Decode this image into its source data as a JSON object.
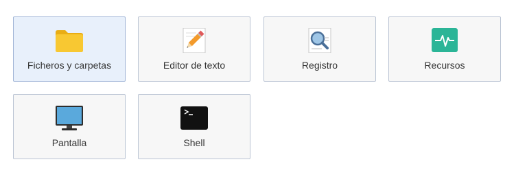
{
  "tiles": [
    {
      "label": "Ficheros y carpetas",
      "icon": "folder-icon",
      "selected": true
    },
    {
      "label": "Editor de texto",
      "icon": "text-editor-icon",
      "selected": false
    },
    {
      "label": "Registro",
      "icon": "log-search-icon",
      "selected": false
    },
    {
      "label": "Recursos",
      "icon": "resources-monitor-icon",
      "selected": false
    },
    {
      "label": "Pantalla",
      "icon": "monitor-icon",
      "selected": false
    },
    {
      "label": "Shell",
      "icon": "terminal-icon",
      "selected": false
    }
  ],
  "colors": {
    "selected_bg": "#e8f0fb",
    "tile_bg": "#f7f7f7",
    "border": "#b9c3d3",
    "folder": "#f7c325",
    "resources": "#2bb597",
    "monitor": "#5aa9dc",
    "terminal": "#111111"
  }
}
